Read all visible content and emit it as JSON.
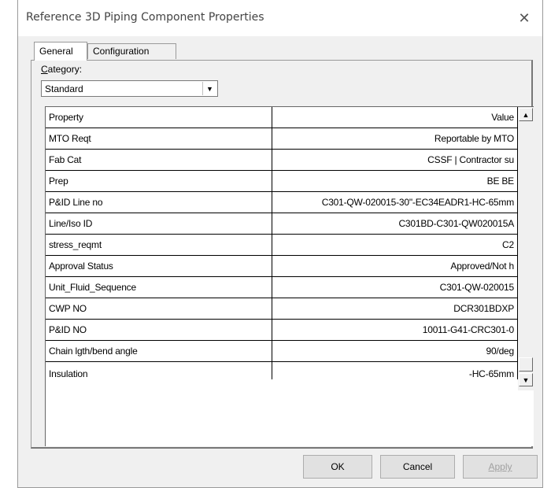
{
  "window": {
    "title": "Reference 3D Piping Component Properties",
    "close_glyph": "✕"
  },
  "tabs": [
    {
      "label": "General"
    },
    {
      "label": "Configuration"
    }
  ],
  "category": {
    "label_rest": "ategory:",
    "label_mnemonic": "C",
    "selected": "Standard"
  },
  "grid": {
    "headers": {
      "property": "Property",
      "value": "Value"
    },
    "rows": [
      {
        "property": "MTO Reqt",
        "value": "Reportable by MTO"
      },
      {
        "property": "Fab Cat",
        "value": "CSSF | Contractor su"
      },
      {
        "property": "Prep",
        "value": "BE BE"
      },
      {
        "property": "P&ID Line no",
        "value": "C301-QW-020015-30\"-EC34EADR1-HC-65mm"
      },
      {
        "property": "Line/Iso ID",
        "value": "C301BD-C301-QW020015A"
      },
      {
        "property": "stress_reqmt",
        "value": "C2"
      },
      {
        "property": "Approval Status",
        "value": "Approved/Not h"
      },
      {
        "property": "Unit_Fluid_Sequence",
        "value": "C301-QW-020015"
      },
      {
        "property": "CWP NO",
        "value": "DCR301BDXP"
      },
      {
        "property": "P&ID NO",
        "value": "10011-G41-CRC301-0"
      },
      {
        "property": "Chain lgth/bend angle",
        "value": "90/deg"
      },
      {
        "property": "Insulation",
        "value": "-HC-65mm"
      }
    ]
  },
  "buttons": {
    "ok": "OK",
    "cancel": "Cancel",
    "apply": "Apply"
  }
}
